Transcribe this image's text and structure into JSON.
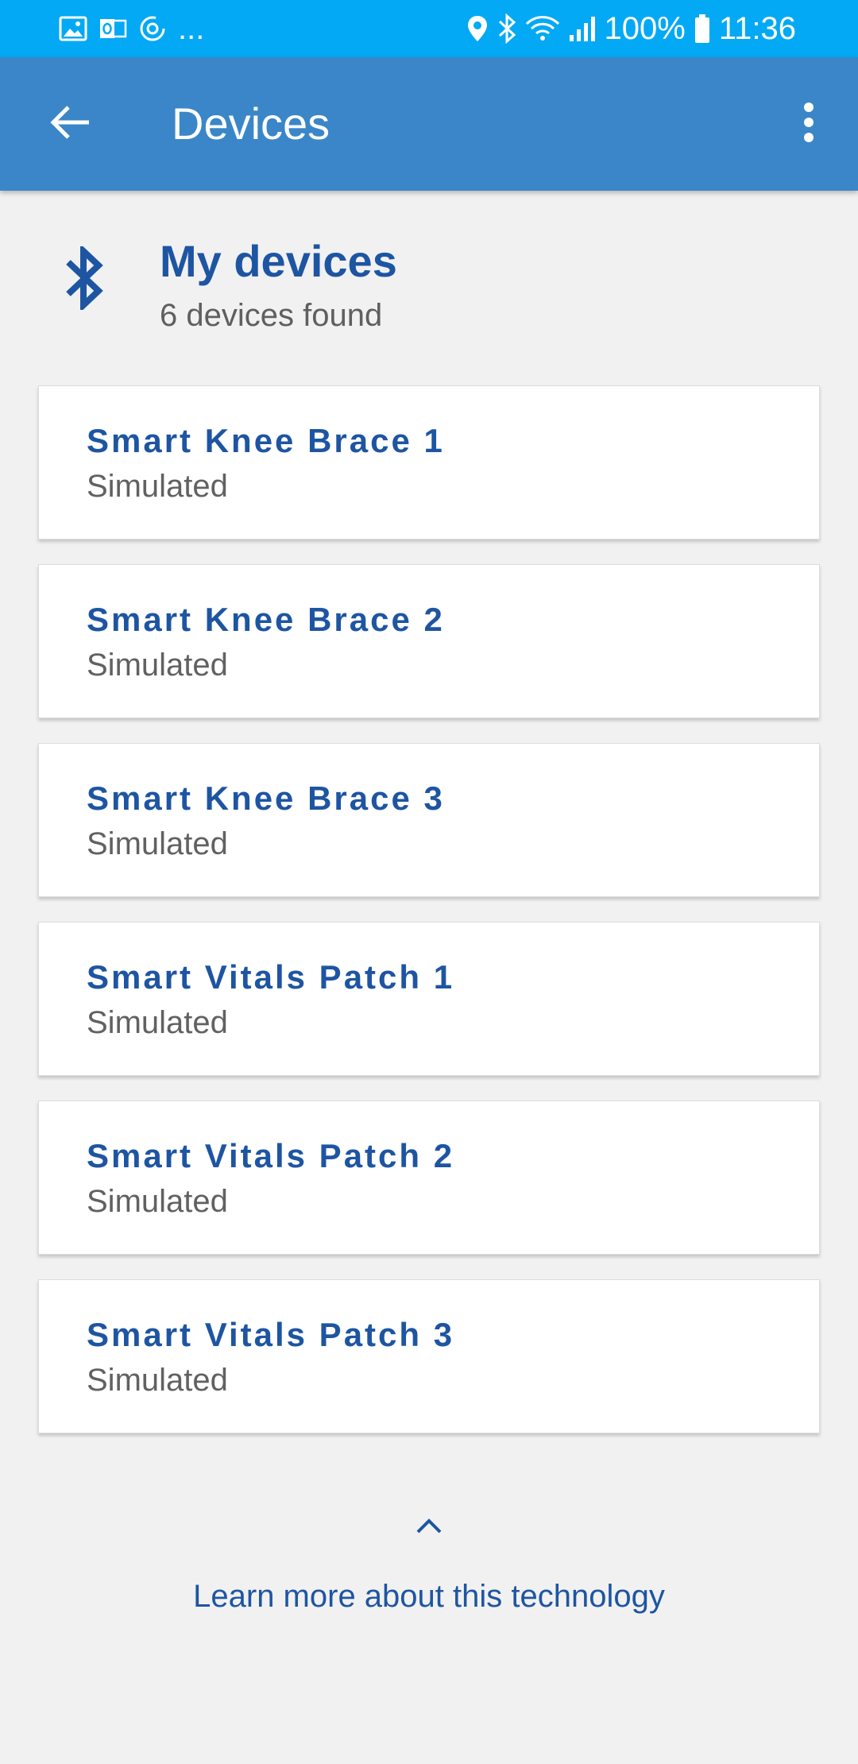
{
  "status_bar": {
    "notification_icons": [
      "gallery-icon",
      "outlook-icon",
      "sync-icon"
    ],
    "overflow": "...",
    "battery": "100%",
    "time": "11:36",
    "system_icons": [
      "location-icon",
      "bluetooth-icon",
      "wifi-icon",
      "signal-icon",
      "battery-icon"
    ]
  },
  "app_bar": {
    "title": "Devices"
  },
  "section": {
    "title": "My devices",
    "subtitle": "6 devices found"
  },
  "devices": [
    {
      "name": "Smart Knee Brace 1",
      "status": "Simulated"
    },
    {
      "name": "Smart Knee Brace 2",
      "status": "Simulated"
    },
    {
      "name": "Smart Knee Brace 3",
      "status": "Simulated"
    },
    {
      "name": "Smart Vitals Patch 1",
      "status": "Simulated"
    },
    {
      "name": "Smart Vitals Patch 2",
      "status": "Simulated"
    },
    {
      "name": "Smart Vitals Patch 3",
      "status": "Simulated"
    }
  ],
  "footer": {
    "learn_more": "Learn more about this technology"
  },
  "colors": {
    "status_bar": "#03a9f4",
    "app_bar": "#3a86c8",
    "accent": "#1e55a2",
    "background": "#f1f1f1"
  }
}
